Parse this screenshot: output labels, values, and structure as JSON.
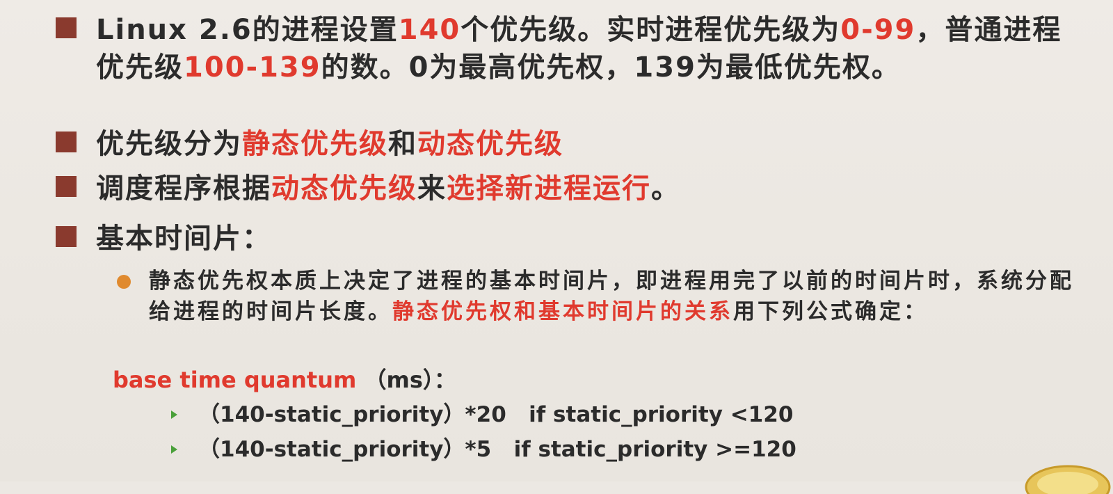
{
  "bullets": {
    "b1": {
      "t1": "Linux 2.6的进程设置",
      "t2": "140",
      "t3": "个优先级。实时进程优先级为",
      "t4": "0-99",
      "t5": "，普通进程优先级",
      "t6": "100-139",
      "t7": "的数。0为最高优先权，139为最低优先权。"
    },
    "b2": {
      "t1": "优先级分为",
      "t2": "静态优先级",
      "t3": "和",
      "t4": "动态优先级"
    },
    "b3": {
      "t1": "调度程序根据",
      "t2": "动态优先级",
      "t3": "来",
      "t4": "选择新进程运行",
      "t5": "。"
    },
    "b4": {
      "t1": "基本时间片："
    }
  },
  "sub_point": {
    "t1": "静态优先权本质上决定了进程的基本时间片，即进程用完了以前的时间片时，系统分配给进程的时间片长度。",
    "t2": "静态优先权和基本时间片的关系",
    "t3": "用下列公式确定："
  },
  "formula": {
    "head_red": "base time quantum",
    "head_rest": "（ms）：",
    "line1": "（140-static_priority）*20   if static_priority <120",
    "line2": "（140-static_priority）*5   if static_priority >=120"
  },
  "colors": {
    "bullet_square": "#8a3a2e",
    "highlight_red": "#e03a2e",
    "sub_dot": "#e08a2e",
    "arrow_green": "#4aa03a"
  }
}
